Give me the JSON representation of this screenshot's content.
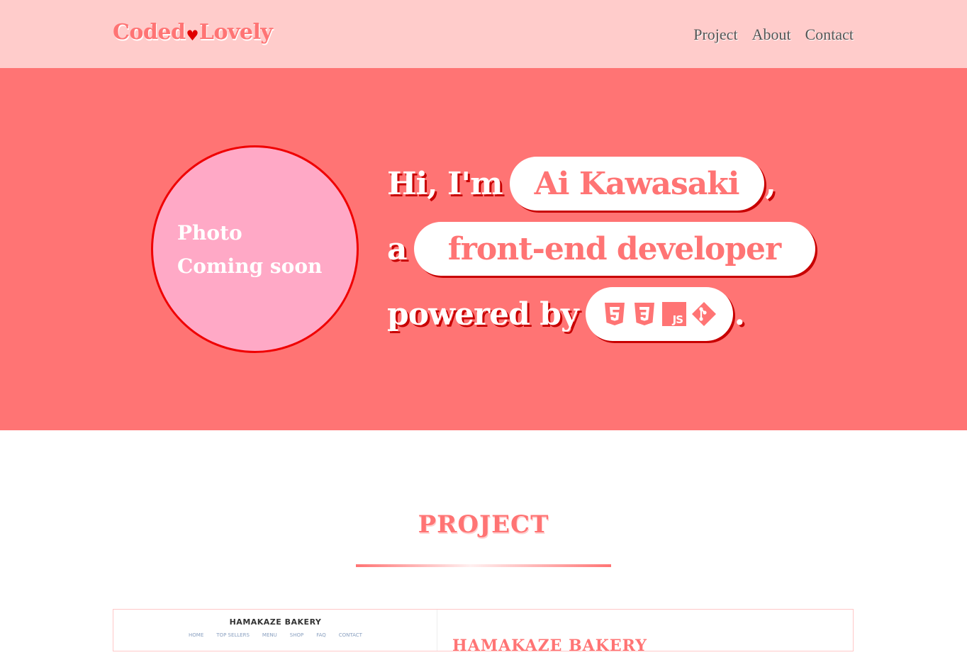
{
  "header": {
    "logo_left": "Coded",
    "logo_heart": "♥",
    "logo_right": "Lovely",
    "nav": [
      {
        "label": "Project"
      },
      {
        "label": "About"
      },
      {
        "label": "Contact"
      }
    ]
  },
  "hero": {
    "photo_line1": "Photo",
    "photo_line2": "Coming soon",
    "line1_prefix": "Hi, I'm",
    "name": "Ai Kawasaki",
    "line1_suffix": ",",
    "line2_prefix": "a",
    "role": "front-end developer",
    "line3_prefix": "powered by",
    "line3_suffix": ".",
    "tech_icons": [
      "html5-icon",
      "css3-icon",
      "javascript-icon",
      "git-icon"
    ],
    "tech_js_text": "JS"
  },
  "projects": {
    "section_title": "PROJECT",
    "card": {
      "preview_title": "HAMAKAZE BAKERY",
      "preview_nav": [
        "HOME",
        "TOP SELLERS",
        "MENU",
        "SHOP",
        "FAQ",
        "CONTACT"
      ],
      "title": "HAMAKAZE BAKERY"
    }
  },
  "colors": {
    "header_bg": "#ffcccb",
    "hero_bg": "#ff7474",
    "accent": "#ff7474",
    "photo_bg": "#ffa9c6",
    "photo_border": "#f00000"
  }
}
